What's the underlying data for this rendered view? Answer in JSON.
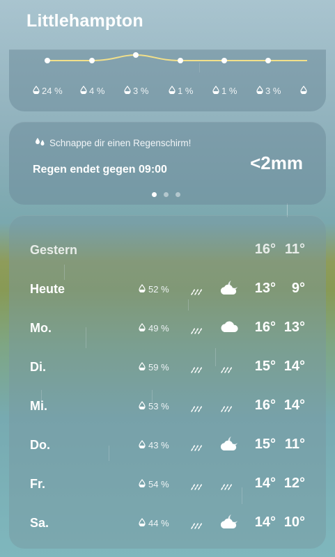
{
  "location": "Littlehampton",
  "hourly": {
    "precip": [
      "24 %",
      "4 %",
      "3 %",
      "1 %",
      "1 %",
      "3 %",
      ""
    ]
  },
  "alert": {
    "hint": "Schnappe dir einen Regenschirm!",
    "message": "Regen endet gegen 09:00",
    "amount": "<2mm",
    "pages": 3,
    "active_page": 1
  },
  "daily": [
    {
      "day": "Gestern",
      "pct": "",
      "hi": "16°",
      "lo": "11°",
      "day_icon": "",
      "night_icon": ""
    },
    {
      "day": "Heute",
      "pct": "52 %",
      "hi": "13°",
      "lo": "9°",
      "day_icon": "rain-icon",
      "night_icon": "cloudy-night-icon"
    },
    {
      "day": "Mo.",
      "pct": "49 %",
      "hi": "16°",
      "lo": "13°",
      "day_icon": "rain-icon",
      "night_icon": "cloud-icon"
    },
    {
      "day": "Di.",
      "pct": "59 %",
      "hi": "15°",
      "lo": "14°",
      "day_icon": "rain-icon",
      "night_icon": "rain-icon"
    },
    {
      "day": "Mi.",
      "pct": "53 %",
      "hi": "16°",
      "lo": "14°",
      "day_icon": "rain-icon",
      "night_icon": "rain-icon"
    },
    {
      "day": "Do.",
      "pct": "43 %",
      "hi": "15°",
      "lo": "11°",
      "day_icon": "rain-icon",
      "night_icon": "cloudy-night-icon"
    },
    {
      "day": "Fr.",
      "pct": "54 %",
      "hi": "14°",
      "lo": "12°",
      "day_icon": "rain-icon",
      "night_icon": "rain-icon"
    },
    {
      "day": "Sa.",
      "pct": "44 %",
      "hi": "14°",
      "lo": "10°",
      "day_icon": "rain-icon",
      "night_icon": "cloudy-night-icon"
    }
  ],
  "colors": {
    "curve": "#f2e08a",
    "accent": "#ffffff"
  }
}
